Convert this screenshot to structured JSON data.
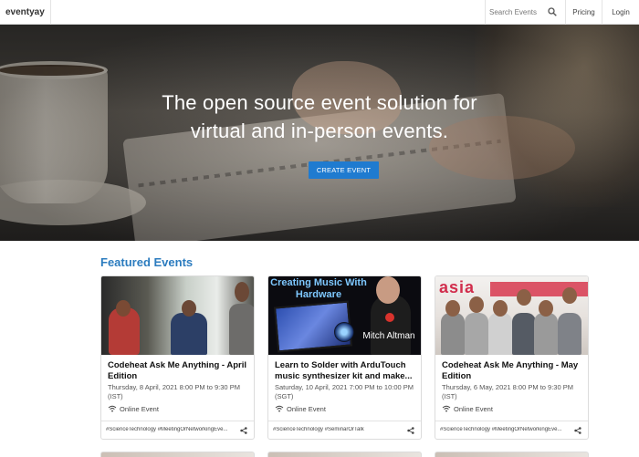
{
  "header": {
    "brand": "eventyay",
    "search_placeholder": "Search Events",
    "search_icon": "search-icon",
    "nav": [
      "Pricing",
      "Login"
    ]
  },
  "hero": {
    "title": "The open source event solution for virtual and in-person events.",
    "cta": "CREATE EVENT"
  },
  "featured": {
    "heading": "Featured Events",
    "cards": [
      {
        "title": "Codeheat Ask Me Anything - April Edition",
        "date": "Thursday, 8 April, 2021 8:00 PM to 9:30 PM (IST)",
        "location": "Online Event",
        "tags": "#ScienceTechnology #MeetingOrNetworkingEve...",
        "share_icon": "share-icon"
      },
      {
        "title": "Learn to Solder with ArduTouch music synthesizer kit and make...",
        "date": "Saturday, 10 April, 2021 7:00 PM to 10:00 PM (SGT)",
        "location": "Online Event",
        "tags": "#ScienceTechnology #SeminarOrTalk",
        "share_icon": "share-icon",
        "image_text": [
          "Creating Music With Hardware",
          "Mitch Altman"
        ]
      },
      {
        "title": "Codeheat Ask Me Anything - May Edition",
        "date": "Thursday, 6 May, 2021 8:00 PM to 9:30 PM (IST)",
        "location": "Online Event",
        "tags": "#ScienceTechnology #MeetingOrNetworkingEve...",
        "share_icon": "share-icon",
        "image_text": [
          "asia"
        ]
      }
    ]
  },
  "colors": {
    "accent": "#2c7cbf",
    "button": "#1f7bd0"
  }
}
